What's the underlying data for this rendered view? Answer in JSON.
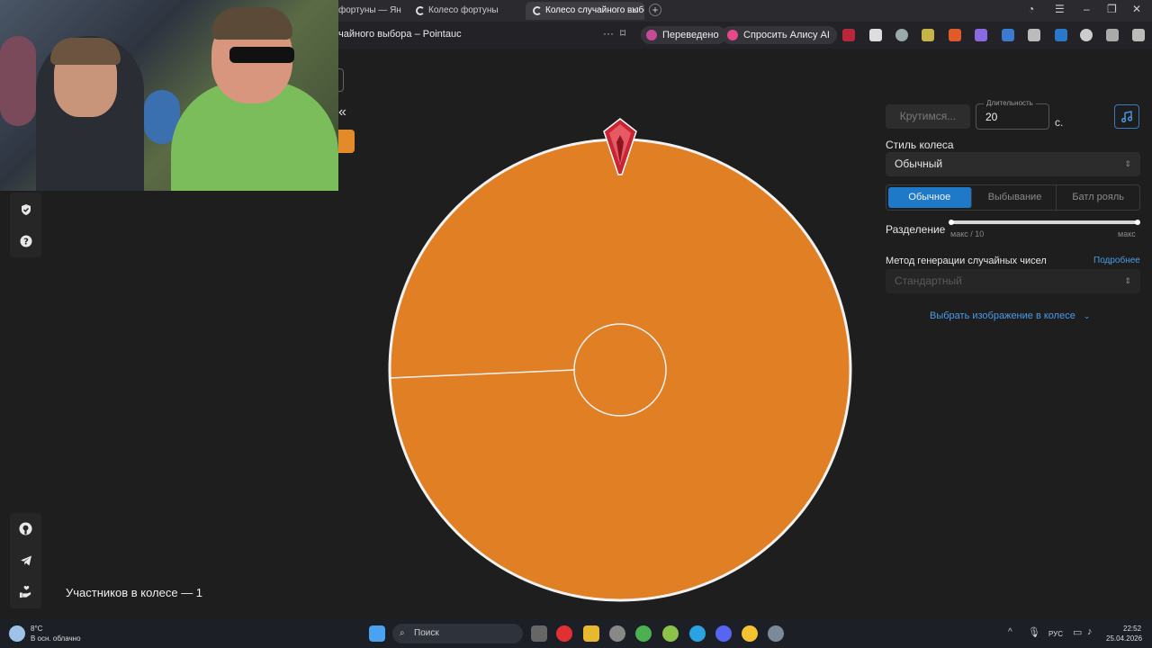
{
  "browser": {
    "tabs": [
      {
        "title": "фортуны — Яндекс"
      },
      {
        "title": "Колесо фортуны"
      },
      {
        "title": "Колесо случайного выбо"
      }
    ],
    "address_title": "чайного выбора – Pointauc",
    "translated_label": "Переведено",
    "ask_alice_label": "Спросить Алису AI"
  },
  "sidebar": {
    "collapse_glyph": "«"
  },
  "wheel": {
    "participants_label": "Участников в колесе — 1",
    "segments": [
      {
        "share": 1.0,
        "color": "#e07f24"
      }
    ],
    "pointer_color": "#d8353f"
  },
  "controls": {
    "spin_button": "Крутимся...",
    "duration_label": "Длительность",
    "duration_value": "20",
    "duration_unit": "с.",
    "style_label": "Стиль колеса",
    "style_value": "Обычный",
    "modes": [
      "Обычное",
      "Выбывание",
      "Батл рояль"
    ],
    "active_mode": "Обычное",
    "split_label": "Разделение",
    "split_min_label": "макс / 10",
    "split_max_label": "макс",
    "rng_label": "Метод генерации случайных чисел",
    "rng_more_link": "Подробнее",
    "rng_value": "Стандартный",
    "image_link": "Выбрать изображение в колесе"
  },
  "taskbar": {
    "weather_temp": "8°C",
    "weather_desc": "В осн. облачно",
    "search_placeholder": "Поиск",
    "lang": "РУС",
    "time": "22:52",
    "date": "25.04.2026"
  },
  "colors": {
    "accent_blue": "#1f79c9",
    "wheel_orange": "#e07f24",
    "link_blue": "#4c9be8"
  }
}
